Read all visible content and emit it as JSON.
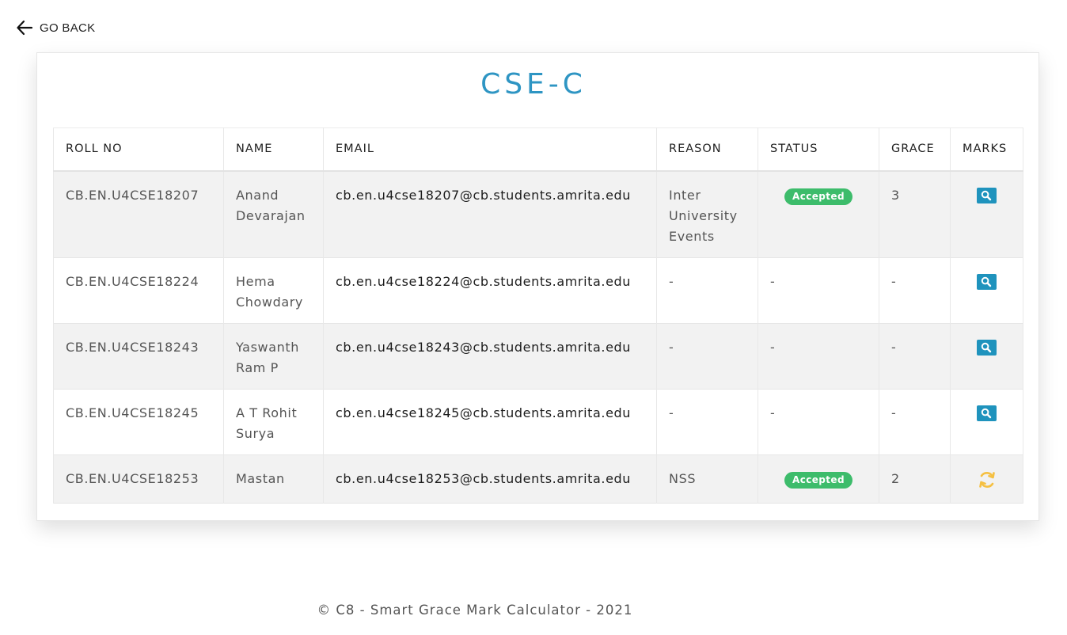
{
  "nav": {
    "back_label": "GO BACK"
  },
  "page": {
    "title": "CSE-C"
  },
  "table": {
    "headers": [
      "ROLL NO",
      "NAME",
      "EMAIL",
      "REASON",
      "STATUS",
      "GRACE",
      "MARKS"
    ],
    "rows": [
      {
        "roll": "CB.EN.U4CSE18207",
        "name": "Anand Devarajan",
        "email": "cb.en.u4cse18207@cb.students.amrita.edu",
        "reason": "Inter University Events",
        "status": "Accepted",
        "grace": "3",
        "marks_icon": "search-icon"
      },
      {
        "roll": "CB.EN.U4CSE18224",
        "name": "Hema Chowdary",
        "email": "cb.en.u4cse18224@cb.students.amrita.edu",
        "reason": "-",
        "status": "-",
        "grace": "-",
        "marks_icon": "search-icon"
      },
      {
        "roll": "CB.EN.U4CSE18243",
        "name": "Yaswanth Ram P",
        "email": "cb.en.u4cse18243@cb.students.amrita.edu",
        "reason": "-",
        "status": "-",
        "grace": "-",
        "marks_icon": "search-icon"
      },
      {
        "roll": "CB.EN.U4CSE18245",
        "name": "A T Rohit Surya",
        "email": "cb.en.u4cse18245@cb.students.amrita.edu",
        "reason": "-",
        "status": "-",
        "grace": "-",
        "marks_icon": "search-icon"
      },
      {
        "roll": "CB.EN.U4CSE18253",
        "name": "Mastan",
        "email": "cb.en.u4cse18253@cb.students.amrita.edu",
        "reason": "NSS",
        "status": "Accepted",
        "grace": "2",
        "marks_icon": "sync-icon"
      }
    ]
  },
  "footer": {
    "text": "© C8 - Smart Grace Mark Calculator - 2021"
  },
  "colors": {
    "title": "#2e95c3",
    "accepted": "#3dbc6b",
    "search_button": "#1f93bd",
    "sync_icon": "#f5c043"
  }
}
